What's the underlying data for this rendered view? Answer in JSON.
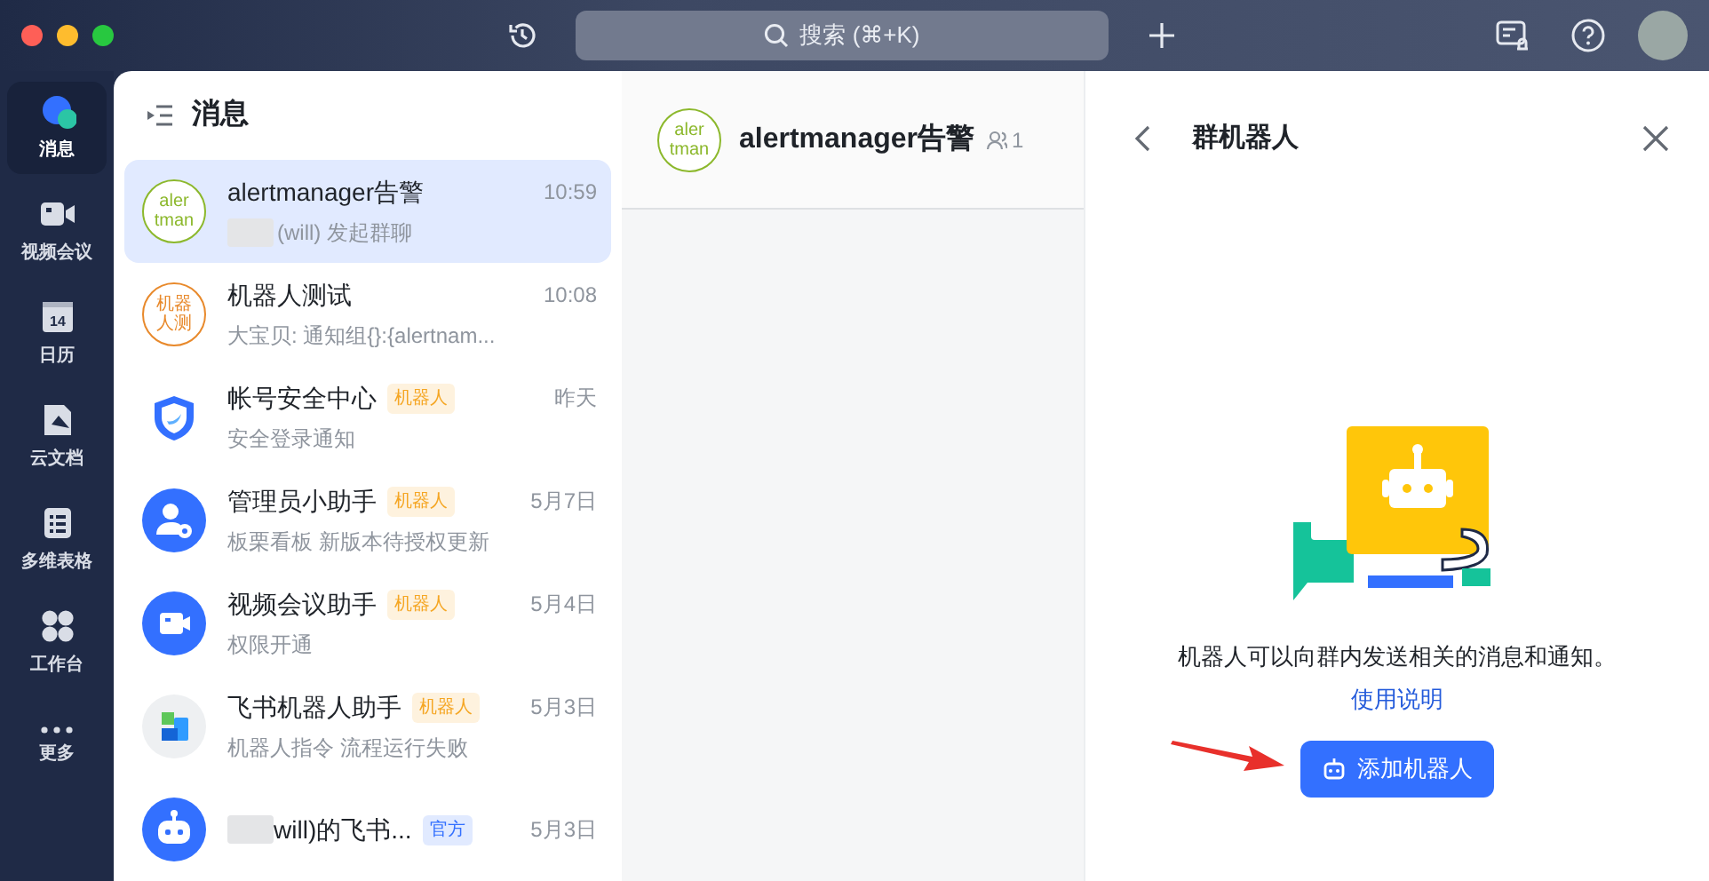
{
  "titlebar": {
    "search_placeholder": "搜索 (⌘+K)"
  },
  "nav": [
    {
      "kind": "chat",
      "label": "消息",
      "selected": true
    },
    {
      "kind": "video",
      "label": "视频会议",
      "selected": false
    },
    {
      "kind": "calendar",
      "label": "日历",
      "selected": false,
      "icon_text": "14"
    },
    {
      "kind": "docs",
      "label": "云文档",
      "selected": false
    },
    {
      "kind": "sheet",
      "label": "多维表格",
      "selected": false
    },
    {
      "kind": "apps",
      "label": "工作台",
      "selected": false
    },
    {
      "kind": "more",
      "label": "更多",
      "selected": false
    }
  ],
  "message_list": {
    "title": "消息",
    "conversations": [
      {
        "avatar": {
          "kind": "text",
          "lines": [
            "aler",
            "tman"
          ],
          "color": "#8cb82c"
        },
        "name": "alertmanager告警",
        "time": "10:59",
        "preview": "(will) 发起群聊",
        "preview_redacted": true,
        "selected": true
      },
      {
        "avatar": {
          "kind": "text",
          "lines": [
            "机器",
            "人测"
          ],
          "color": "#e8892b"
        },
        "name": "机器人测试",
        "time": "10:08",
        "preview": "大宝贝: 通知组{}:{alertnam...",
        "selected": false
      },
      {
        "avatar": {
          "kind": "shield"
        },
        "name": "帐号安全中心",
        "tag": {
          "text": "机器人",
          "color": "#f5a623"
        },
        "time": "昨天",
        "preview": "安全登录通知",
        "selected": false
      },
      {
        "avatar": {
          "kind": "user-gear"
        },
        "name": "管理员小助手",
        "tag": {
          "text": "机器人",
          "color": "#f5a623"
        },
        "time": "5月7日",
        "preview": "板栗看板 新版本待授权更新",
        "selected": false
      },
      {
        "avatar": {
          "kind": "video"
        },
        "name": "视频会议助手",
        "tag": {
          "text": "机器人",
          "color": "#f5a623"
        },
        "time": "5月4日",
        "preview": "权限开通",
        "selected": false
      },
      {
        "avatar": {
          "kind": "blocks"
        },
        "name": "飞书机器人助手",
        "tag": {
          "text": "机器人",
          "color": "#f5a623"
        },
        "time": "5月3日",
        "preview": "机器人指令 流程运行失败",
        "selected": false
      },
      {
        "avatar": {
          "kind": "robot"
        },
        "name": "will)的飞书...",
        "name_redacted": true,
        "tag": {
          "text": "官方",
          "color": "#3370ff"
        },
        "time": "5月3日",
        "selected": false
      }
    ]
  },
  "chat": {
    "avatar": {
      "lines": [
        "aler",
        "tman"
      ],
      "color": "#8cb82c"
    },
    "title": "alertmanager告警",
    "member_count": "1"
  },
  "panel": {
    "title": "群机器人",
    "description": "机器人可以向群内发送相关的消息和通知。",
    "help_link": "使用说明",
    "add_button": "添加机器人"
  }
}
